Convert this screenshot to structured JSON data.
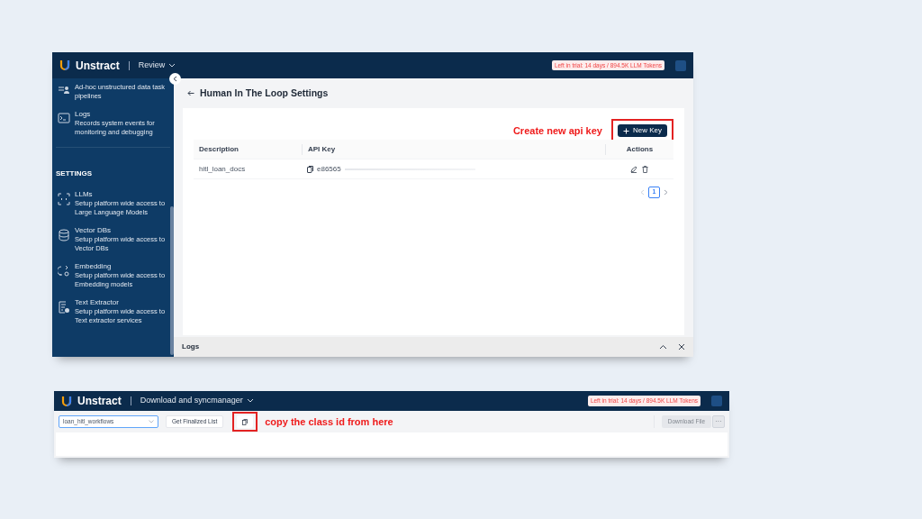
{
  "settings_screenshot": {
    "header": {
      "brand": "Unstract",
      "section": "Review",
      "trial_badge": "Left in trial: 14 days / 894.5K LLM Tokens"
    },
    "sidebar": {
      "items": [
        {
          "kind": "item",
          "description": "Ad-hoc unstructured data task pipelines"
        },
        {
          "kind": "item",
          "title": "Logs",
          "description": "Records system events for monitoring and debugging"
        },
        {
          "kind": "heading",
          "title": "SETTINGS"
        },
        {
          "kind": "item",
          "title": "LLMs",
          "description": "Setup platform wide access to Large Language Models"
        },
        {
          "kind": "item",
          "title": "Vector DBs",
          "description": "Setup platform wide access to Vector DBs"
        },
        {
          "kind": "item",
          "title": "Embedding",
          "description": "Setup platform wide access to Embedding models"
        },
        {
          "kind": "item",
          "title": "Text Extractor",
          "description": "Setup platform wide access to Text extractor services"
        }
      ]
    },
    "page_title": "Human In The Loop Settings",
    "annotation": "Create new api key",
    "new_key_button": "New Key",
    "table": {
      "columns": [
        "Description",
        "API Key",
        "Actions"
      ],
      "rows": [
        {
          "description": "hitl_loan_docs",
          "api_key": "e86565"
        }
      ]
    },
    "pagination": [
      {
        "label": "1",
        "selected": true
      }
    ],
    "logs_panel": "Logs"
  },
  "sync_screenshot": {
    "header": {
      "brand": "Unstract",
      "section": "Download and syncmanager",
      "trial_badge": "Left in trial: 14 days / 894.5K LLM Tokens"
    },
    "workflow_select": "loan_hitl_workflows",
    "finalized_button": "Get Finalized List",
    "annotation": "copy the class id from here",
    "download_button": {
      "label": "Download File",
      "disabled": true
    },
    "more_button": "···"
  }
}
